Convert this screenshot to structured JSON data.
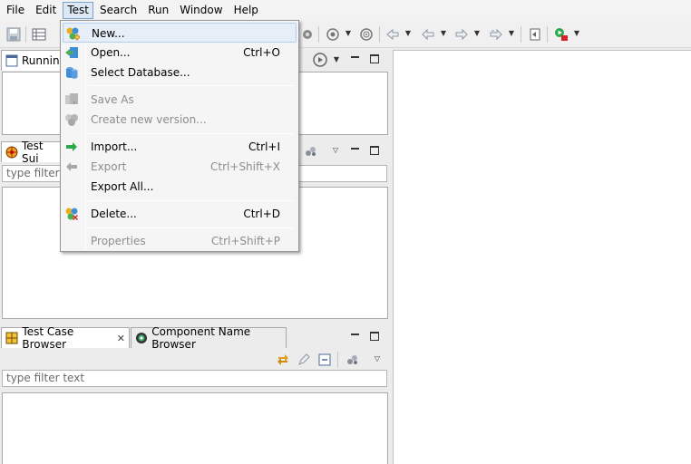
{
  "menubar": {
    "items": [
      "File",
      "Edit",
      "Test",
      "Search",
      "Run",
      "Window",
      "Help"
    ],
    "active": "Test"
  },
  "toolbar": {
    "icons": [
      "save-icon",
      "table-icon",
      "target-icon",
      "crosshair-icon",
      "back-icon",
      "prev-icon",
      "next-icon",
      "forward-icon",
      "refresh-icon",
      "run-test-icon"
    ]
  },
  "test_menu": {
    "items": [
      {
        "label": "New...",
        "shortcut": "",
        "enabled": true,
        "icon": "new-icon"
      },
      {
        "label": "Open...",
        "shortcut": "Ctrl+O",
        "enabled": true,
        "icon": "open-icon"
      },
      {
        "label": "Select Database...",
        "shortcut": "",
        "enabled": true,
        "icon": "database-icon"
      },
      {
        "label": "Save As",
        "shortcut": "",
        "enabled": false,
        "icon": "save-as-icon"
      },
      {
        "label": "Create new version...",
        "shortcut": "",
        "enabled": false,
        "icon": "new-version-icon"
      },
      {
        "label": "Import...",
        "shortcut": "Ctrl+I",
        "enabled": true,
        "icon": "import-icon"
      },
      {
        "label": "Export",
        "shortcut": "Ctrl+Shift+X",
        "enabled": false,
        "icon": "export-icon"
      },
      {
        "label": "Export All...",
        "shortcut": "",
        "enabled": true,
        "icon": ""
      },
      {
        "label": "Delete...",
        "shortcut": "Ctrl+D",
        "enabled": true,
        "icon": "delete-icon"
      },
      {
        "label": "Properties",
        "shortcut": "Ctrl+Shift+P",
        "enabled": false,
        "icon": ""
      }
    ]
  },
  "views": {
    "running": {
      "tab_label": "Running"
    },
    "test_suite": {
      "tab_label": "Test Sui",
      "filter_placeholder": "type filter t"
    },
    "bottom": {
      "tabs": [
        {
          "label": "Test Case Browser",
          "active": true
        },
        {
          "label": "Component Name Browser",
          "active": false
        }
      ],
      "filter_placeholder": "type filter text"
    }
  },
  "colors": {
    "menu_hover": "#e8eef7",
    "menu_hover_border": "#aecff7",
    "active_menu": "#dce8f6"
  }
}
